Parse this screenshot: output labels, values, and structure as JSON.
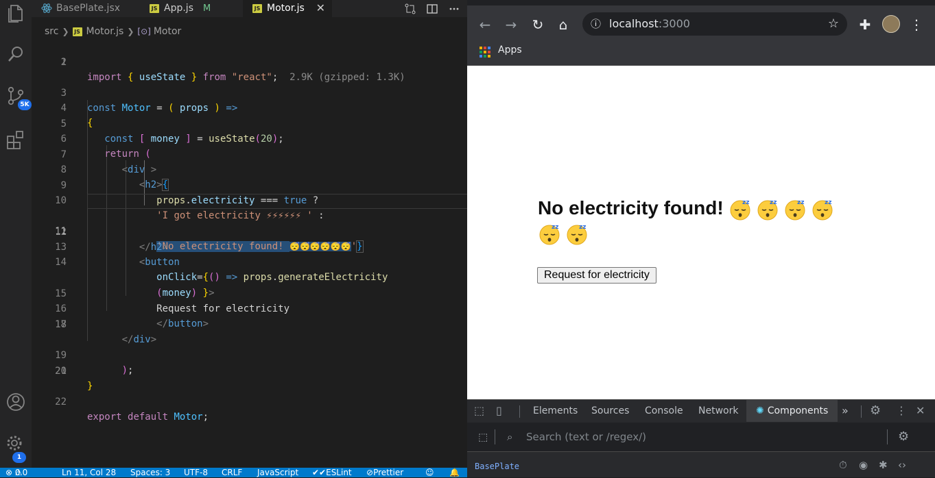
{
  "editor": {
    "tabs": [
      {
        "label": "BasePlate.jsx",
        "kind": "react"
      },
      {
        "label": "App.js",
        "kind": "js",
        "status": "M"
      },
      {
        "label": "Motor.js",
        "kind": "js",
        "close": "✕"
      }
    ],
    "js_badge": "JS",
    "breadcrumb": {
      "folder": "src",
      "file": "Motor.js",
      "symbol": "Motor"
    },
    "line_numbers": [
      "1",
      "2",
      "3",
      "4",
      "5",
      "6",
      "7",
      "8",
      "9",
      "10",
      "11",
      "12",
      "13",
      "14",
      "",
      "15",
      "16",
      "17",
      "18",
      "19",
      "20",
      "21",
      "22"
    ],
    "active_line": "11",
    "code": {
      "l1": {
        "import": "import",
        "b1": "{",
        "useState": "useState",
        "b2": "}",
        "from": "from",
        "react": "\"react\"",
        "semi": ";",
        "hint": "2.9K (gzipped: 1.3K)"
      },
      "l3": {
        "const": "const",
        "name": "Motor",
        "eq": "=",
        "p1": "(",
        "props": "props",
        "p2": ")",
        "arrow": "=>"
      },
      "l4": {
        "brace": "{"
      },
      "l5": {
        "const": "const",
        "b1": "[",
        "money": "money",
        "b2": "]",
        "eq": "=",
        "fn": "useState",
        "p1": "(",
        "n": "20",
        "p2": ")",
        "semi": ";"
      },
      "l6": {
        "return": "return",
        "p": "("
      },
      "l7": {
        "open": "<",
        "tag": "div",
        "close": " >"
      },
      "l8": {
        "open": "<",
        "tag": "h2",
        "close": ">",
        "brace": "{"
      },
      "l9": {
        "props": "props",
        "dot": ".",
        "prop": "electricity",
        "op": "===",
        "true": "true",
        "q": "?"
      },
      "l10": {
        "str": "'I got electricity ⚡⚡⚡⚡⚡⚡ '",
        "colon": ":"
      },
      "l11": {
        "str1": "'No electricity found! ",
        "emojis": "😴😴😴😴😴😴",
        "str2": "'",
        "brace": "}"
      },
      "l12": {
        "open": "</",
        "tag": "h2",
        "close": ">"
      },
      "l13": {
        "open": "<",
        "tag": "button"
      },
      "l14": {
        "attr": "onClick",
        "eq": "=",
        "b": "{",
        "p": "()",
        "arrow": "=>",
        "props": "props",
        "dot": ".",
        "fn": "generateElectricity"
      },
      "l14b": {
        "p1": "(",
        "money": "money",
        "p2": ")",
        "b": "}",
        "gt": ">"
      },
      "l15": {
        "text": "Request for electricity"
      },
      "l16": {
        "open": "</",
        "tag": "button",
        "close": ">"
      },
      "l17": {
        "open": "</",
        "tag": "div",
        "close": ">"
      },
      "l19": {
        "p": ")",
        "semi": ";"
      },
      "l20": {
        "brace": "}"
      },
      "l22": {
        "export": "export",
        "default": "default",
        "name": "Motor",
        "semi": ";"
      }
    },
    "activity": {
      "scm_badge": "5K",
      "settings_badge": "1"
    },
    "status": {
      "errors": "0",
      "warnings": "0",
      "cursor": "Ln 11, Col 28",
      "spaces": "Spaces: 3",
      "encoding": "UTF-8",
      "eol": "CRLF",
      "language": "JavaScript",
      "eslint": "ESLint",
      "prettier": "Prettier"
    }
  },
  "browser": {
    "url_host": "localhost",
    "url_port": ":3000",
    "bookmark": "Apps",
    "page": {
      "heading": "No electricity found!",
      "emoji_count": 6,
      "button": "Request for electricity"
    },
    "devtools": {
      "tabs": [
        "Elements",
        "Sources",
        "Console",
        "Network",
        "Components"
      ],
      "active_tab": "Components",
      "more": "»",
      "search_placeholder": "Search (text or /regex/)",
      "tree_root": "BasePlate"
    }
  }
}
